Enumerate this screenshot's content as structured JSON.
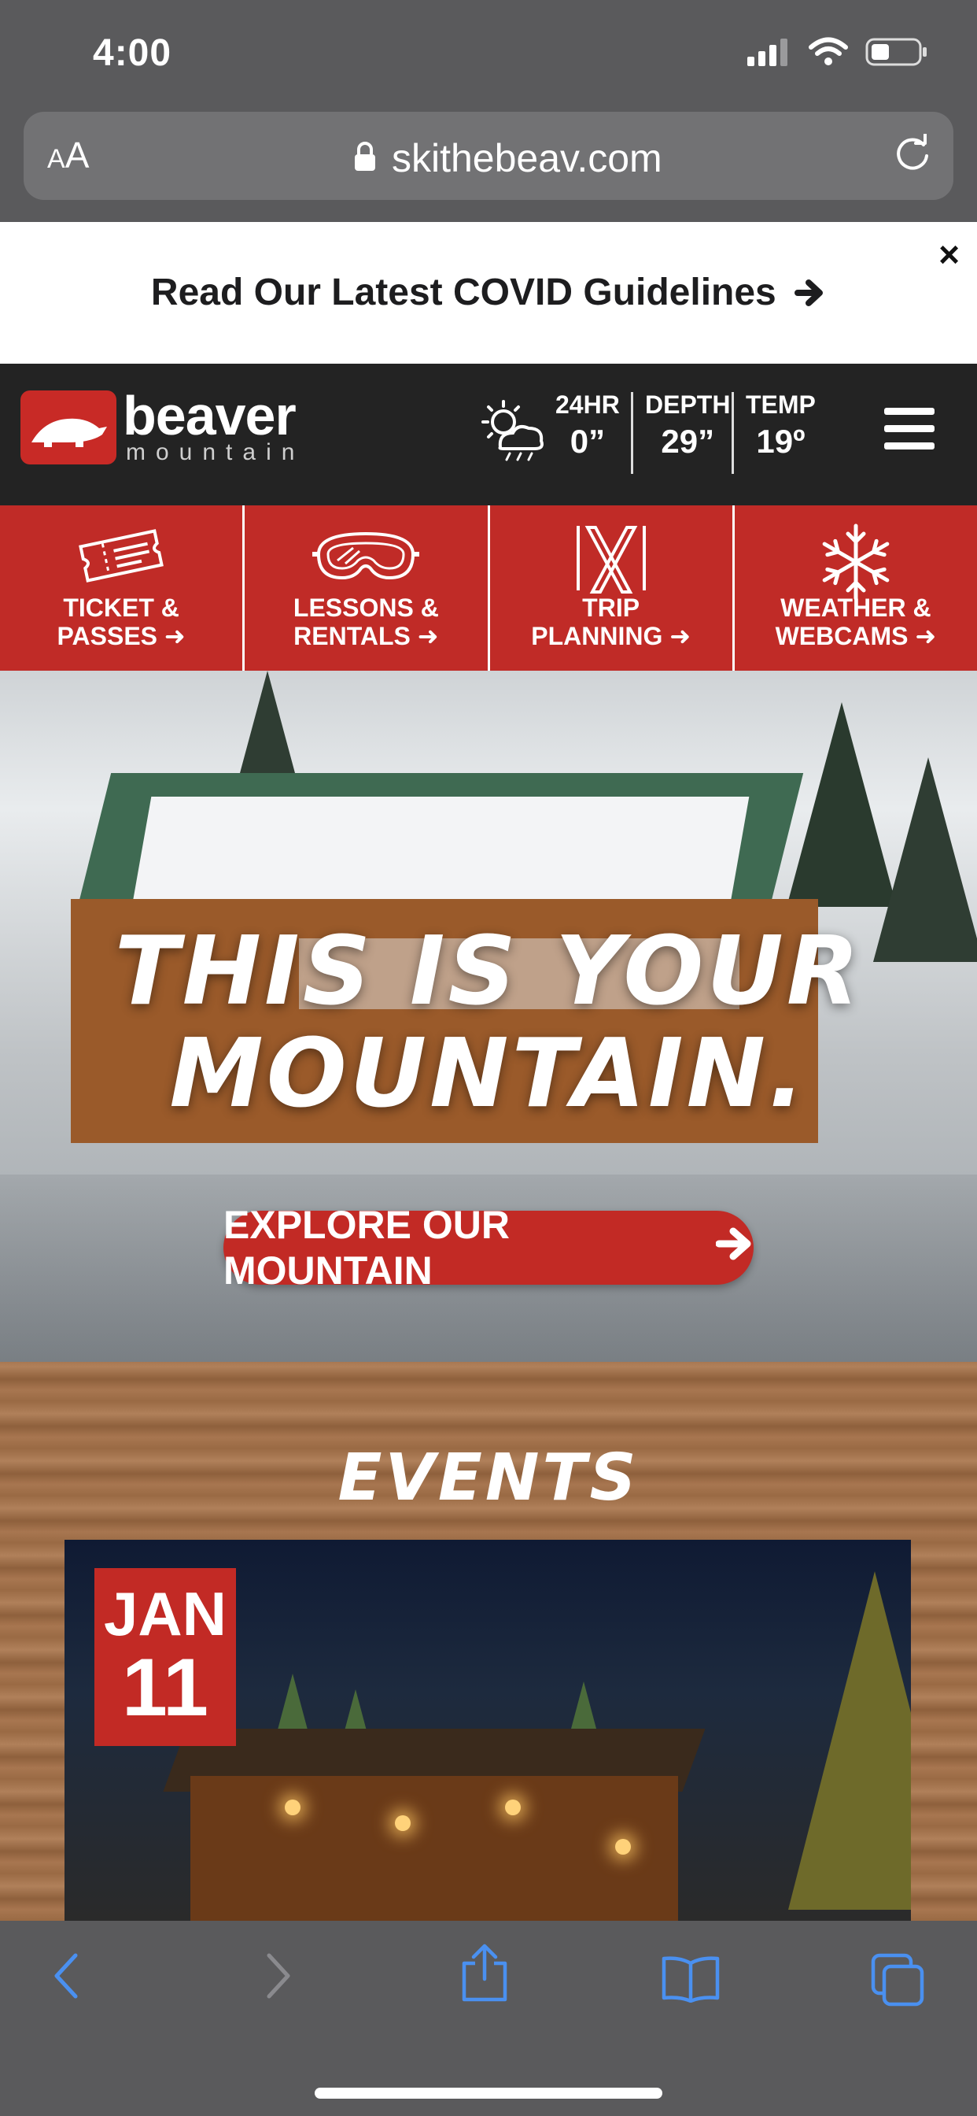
{
  "status_bar": {
    "time": "4:00"
  },
  "browser": {
    "text_size_label": "AA",
    "url": "skithebeav.com"
  },
  "banner": {
    "text": "Read Our Latest COVID Guidelines",
    "close": "×"
  },
  "header": {
    "logo_word": "beaver",
    "logo_sub": "mountain",
    "stats": [
      {
        "label": "24HR",
        "value": "0”"
      },
      {
        "label": "DEPTH",
        "value": "29”"
      },
      {
        "label": "TEMP",
        "value": "19º"
      }
    ]
  },
  "quick_nav": [
    {
      "line1": "TICKET &",
      "line2": "PASSES",
      "icon": "ticket-icon"
    },
    {
      "line1": "LESSONS &",
      "line2": "RENTALS",
      "icon": "goggles-icon"
    },
    {
      "line1": "TRIP",
      "line2": "PLANNING",
      "icon": "skis-icon"
    },
    {
      "line1": "WEATHER &",
      "line2": "WEBCAMS",
      "icon": "snowflake-icon"
    }
  ],
  "hero": {
    "title_line1": "THIS IS YOUR",
    "title_line2": "MOUNTAIN.",
    "cta": "EXPLORE OUR MOUNTAIN"
  },
  "events": {
    "title": "EVENTS",
    "items": [
      {
        "month": "JAN",
        "day": "11"
      }
    ]
  },
  "colors": {
    "brand_red": "#c22a25",
    "header_bg": "#232323",
    "safari_ui": "#5a5a5c",
    "toolbar_blue": "#4a90f0"
  }
}
